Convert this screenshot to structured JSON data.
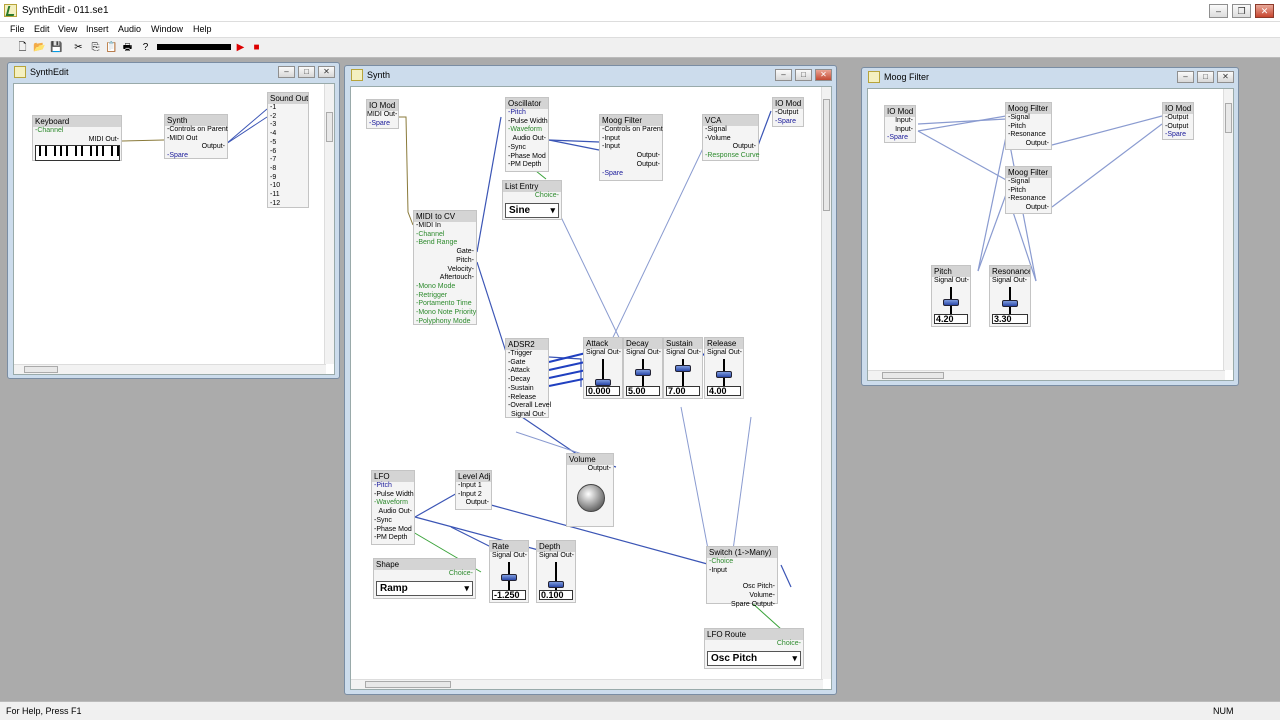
{
  "app": {
    "title": "SynthEdit - 011.se1"
  },
  "menu": [
    "File",
    "Edit",
    "View",
    "Insert",
    "Audio",
    "Window",
    "Help"
  ],
  "status": {
    "help": "For Help, Press F1",
    "num": "NUM"
  },
  "windows": {
    "synthedit": {
      "title": "SynthEdit",
      "keyboard": {
        "title": "Keyboard",
        "pins": [
          "-Channel"
        ],
        "out": "MIDI Out-"
      },
      "synth": {
        "title": "Synth",
        "pins": [
          "-Controls on Parent",
          "-MIDI Out",
          "-Spare"
        ],
        "out": "Output-"
      },
      "sound_out": {
        "title": "Sound Out",
        "pins": [
          "-1",
          "-2",
          "-3",
          "-4",
          "-5",
          "-6",
          "-7",
          "-8",
          "-9",
          "-10",
          "-11",
          "-12"
        ]
      }
    },
    "synth": {
      "title": "Synth",
      "io_mod_left": {
        "title": "IO Mod",
        "pins": [
          "MIDI Out-",
          "-Spare"
        ]
      },
      "oscillator": {
        "title": "Oscillator",
        "pins": [
          "-Pitch",
          "-Pulse Width",
          "-Waveform",
          "Audio Out-",
          "-Sync",
          "-Phase Mod",
          "-PM Depth"
        ]
      },
      "moog_filter": {
        "title": "Moog Filter",
        "pins": [
          "-Controls on Parent",
          "-Input",
          "-Input",
          "Output-",
          "Output-",
          "-Spare"
        ]
      },
      "vca": {
        "title": "VCA",
        "pins": [
          "-Signal",
          "-Volume",
          "Output-",
          "-Response Curve"
        ]
      },
      "io_mod_right": {
        "title": "IO Mod",
        "pins": [
          "-Output",
          "-Spare"
        ]
      },
      "list_entry": {
        "title": "List Entry",
        "choice": "Choice-",
        "value": "Sine"
      },
      "midi_to_cv": {
        "title": "MIDI to CV",
        "pins": [
          "-MIDI In",
          "-Channel",
          "-Bend Range",
          "Gate-",
          "Pitch-",
          "Velocity-",
          "Aftertouch-",
          "-Mono Mode",
          "-Retrigger",
          "-Portamento Time",
          "-Mono Note Priority",
          "-Polyphony Mode"
        ]
      },
      "adsr2": {
        "title": "ADSR2",
        "pins": [
          "-Trigger",
          "-Gate",
          "-Attack",
          "-Decay",
          "-Sustain",
          "-Release",
          "-Overall Level",
          "Signal Out-"
        ]
      },
      "attack": {
        "title": "Attack",
        "sig": "Signal Out-",
        "value": "0.000",
        "level": 0.0
      },
      "decay": {
        "title": "Decay",
        "sig": "Signal Out-",
        "value": "5.00",
        "level": 0.5
      },
      "sustain": {
        "title": "Sustain",
        "sig": "Signal Out-",
        "value": "7.00",
        "level": 0.7
      },
      "release": {
        "title": "Release",
        "sig": "Signal Out-",
        "value": "4.00",
        "level": 0.4
      },
      "volume": {
        "title": "Volume",
        "out": "Output-"
      },
      "lfo": {
        "title": "LFO",
        "pins": [
          "-Pitch",
          "-Pulse Width",
          "-Waveform",
          "Audio Out-",
          "-Sync",
          "-Phase Mod",
          "-PM Depth"
        ]
      },
      "level_adj": {
        "title": "Level Adj",
        "pins": [
          "-Input 1",
          "-Input 2",
          "Output-"
        ]
      },
      "rate": {
        "title": "Rate",
        "sig": "Signal Out-",
        "value": "-1.250",
        "level": 0.45
      },
      "depth": {
        "title": "Depth",
        "sig": "Signal Out-",
        "value": "0.100",
        "level": 0.1
      },
      "shape": {
        "title": "Shape",
        "choice": "Choice-",
        "value": "Ramp"
      },
      "switch": {
        "title": "Switch (1->Many)",
        "pins": [
          "-Choice",
          "-Input",
          "Osc Pitch-",
          "Volume-",
          "Spare Output-"
        ]
      },
      "lfo_route": {
        "title": "LFO Route",
        "choice": "Choice-",
        "value": "Osc Pitch"
      }
    },
    "moog": {
      "title": "Moog Filter",
      "io_mod_left": {
        "title": "IO Mod",
        "pins": [
          "Input-",
          "Input-",
          "-Spare"
        ]
      },
      "moog1": {
        "title": "Moog Filter",
        "pins": [
          "-Signal",
          "-Pitch",
          "-Resonance",
          "Output-"
        ]
      },
      "moog2": {
        "title": "Moog Filter",
        "pins": [
          "-Signal",
          "-Pitch",
          "-Resonance",
          "Output-"
        ]
      },
      "io_mod_right": {
        "title": "IO Mod",
        "pins": [
          "-Output",
          "-Output",
          "-Spare"
        ]
      },
      "pitch": {
        "title": "Pitch",
        "sig": "Signal Out-",
        "value": "4.20",
        "level": 0.42
      },
      "resonance": {
        "title": "Resonance",
        "sig": "Signal Out-",
        "value": "3.30",
        "level": 0.33
      }
    }
  },
  "colors": {
    "wire": "#3b55b5",
    "wire_light": "#8a9bd0",
    "midi_wire": "#8a7a3a",
    "green_wire": "#3aa33a"
  }
}
